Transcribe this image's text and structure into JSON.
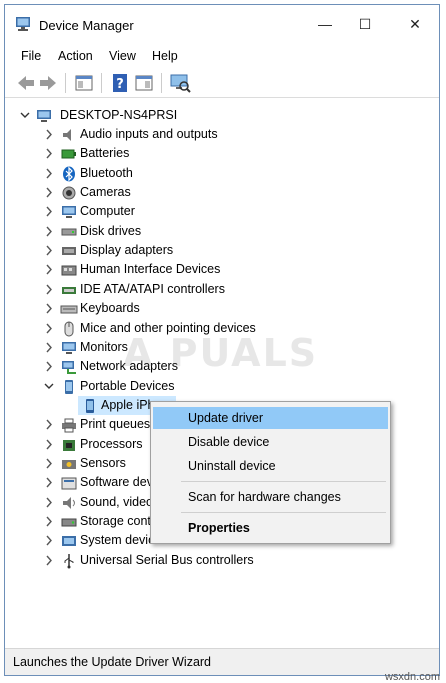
{
  "window": {
    "title": "Device Manager",
    "controls": {
      "minimize": "—",
      "maximize": "☐",
      "close": "✕"
    }
  },
  "menu": [
    "File",
    "Action",
    "View",
    "Help"
  ],
  "tree": {
    "root": "DESKTOP-NS4PRSI",
    "items": [
      {
        "label": "Audio inputs and outputs",
        "icon": "speaker-icon"
      },
      {
        "label": "Batteries",
        "icon": "battery-icon"
      },
      {
        "label": "Bluetooth",
        "icon": "bluetooth-icon"
      },
      {
        "label": "Cameras",
        "icon": "camera-icon"
      },
      {
        "label": "Computer",
        "icon": "monitor-icon"
      },
      {
        "label": "Disk drives",
        "icon": "disk-icon"
      },
      {
        "label": "Display adapters",
        "icon": "display-adapter-icon"
      },
      {
        "label": "Human Interface Devices",
        "icon": "hid-icon"
      },
      {
        "label": "IDE ATA/ATAPI controllers",
        "icon": "ide-icon"
      },
      {
        "label": "Keyboards",
        "icon": "keyboard-icon"
      },
      {
        "label": "Mice and other pointing devices",
        "icon": "mouse-icon"
      },
      {
        "label": "Monitors",
        "icon": "monitor-icon"
      },
      {
        "label": "Network adapters",
        "icon": "network-icon"
      },
      {
        "label": "Portable Devices",
        "icon": "portable-device-icon",
        "expanded": true
      },
      {
        "label": "Apple iPhone",
        "icon": "phone-icon",
        "child": true,
        "selected": true
      },
      {
        "label": "Print queues",
        "icon": "printer-icon"
      },
      {
        "label": "Processors",
        "icon": "processor-icon"
      },
      {
        "label": "Sensors",
        "icon": "sensor-icon"
      },
      {
        "label": "Software dev",
        "icon": "software-device-icon"
      },
      {
        "label": "Sound, video",
        "icon": "sound-icon"
      },
      {
        "label": "Storage cont",
        "icon": "storage-icon"
      },
      {
        "label": "System devic",
        "icon": "system-device-icon"
      },
      {
        "label": "Universal Serial Bus controllers",
        "icon": "usb-icon"
      }
    ]
  },
  "context_menu": {
    "update_driver": "Update driver",
    "disable_device": "Disable device",
    "uninstall_device": "Uninstall device",
    "scan": "Scan for hardware changes",
    "properties": "Properties"
  },
  "status": "Launches the Update Driver Wizard",
  "watermark": "A PUALS",
  "site": "wsxdn.com",
  "colors": {
    "selection": "#cce8ff",
    "menu_highlight": "#91c9f7",
    "border": "#6d8fb8"
  }
}
